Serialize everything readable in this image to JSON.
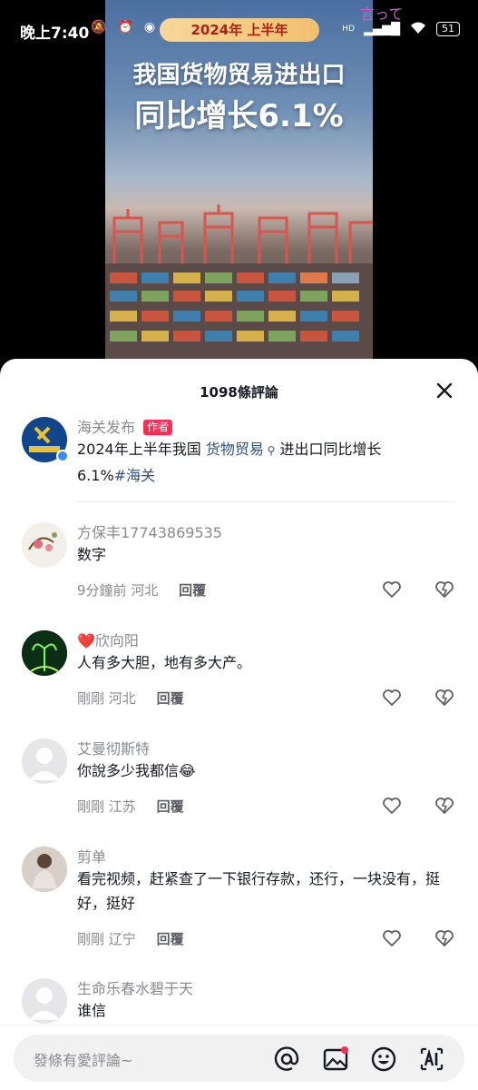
{
  "status_bar": {
    "time": "晚上7:40",
    "network": "HD",
    "battery": "51",
    "corner_text": "言って"
  },
  "video": {
    "pill": "2024年 上半年",
    "headline_1": "我国货物贸易进出口",
    "headline_2": "同比增长6.1%"
  },
  "sheet": {
    "title": "1098條評論",
    "close_icon": "close-icon"
  },
  "comments": [
    {
      "name": "海关发布",
      "badge": "作者",
      "text_pre": "2024年上半年我国 ",
      "link": "货物贸易",
      "text_post": " 进出口同比增长",
      "text_line2_pre": "6.1%",
      "hashtag": "#海关"
    },
    {
      "name": "方保丰17743869535",
      "text": "数字",
      "time": "9分鐘前",
      "location": "河北",
      "reply": "回覆"
    },
    {
      "name": "❤️欣向阳",
      "text": "人有多大胆，地有多大产。",
      "time": "剛剛",
      "location": "河北",
      "reply": "回覆"
    },
    {
      "name": "艾曼彻斯特",
      "text": "你說多少我都信😂",
      "time": "剛剛",
      "location": "江苏",
      "reply": "回覆"
    },
    {
      "name": "剪单",
      "text": "看完视频，赶紧查了一下银行存款，还行，一块没有，挺好，挺好",
      "time": "剛剛",
      "location": "辽宁",
      "reply": "回覆"
    },
    {
      "name": "生命乐春水碧于天",
      "text": "谁信"
    }
  ],
  "input": {
    "placeholder": "發條有愛評論~",
    "icons": [
      "at-icon",
      "image-icon",
      "emoji-icon",
      "ai-icon"
    ]
  },
  "colors": {
    "accent": "#fe2c55",
    "link": "#2d4f86",
    "muted": "#8a8b91"
  }
}
